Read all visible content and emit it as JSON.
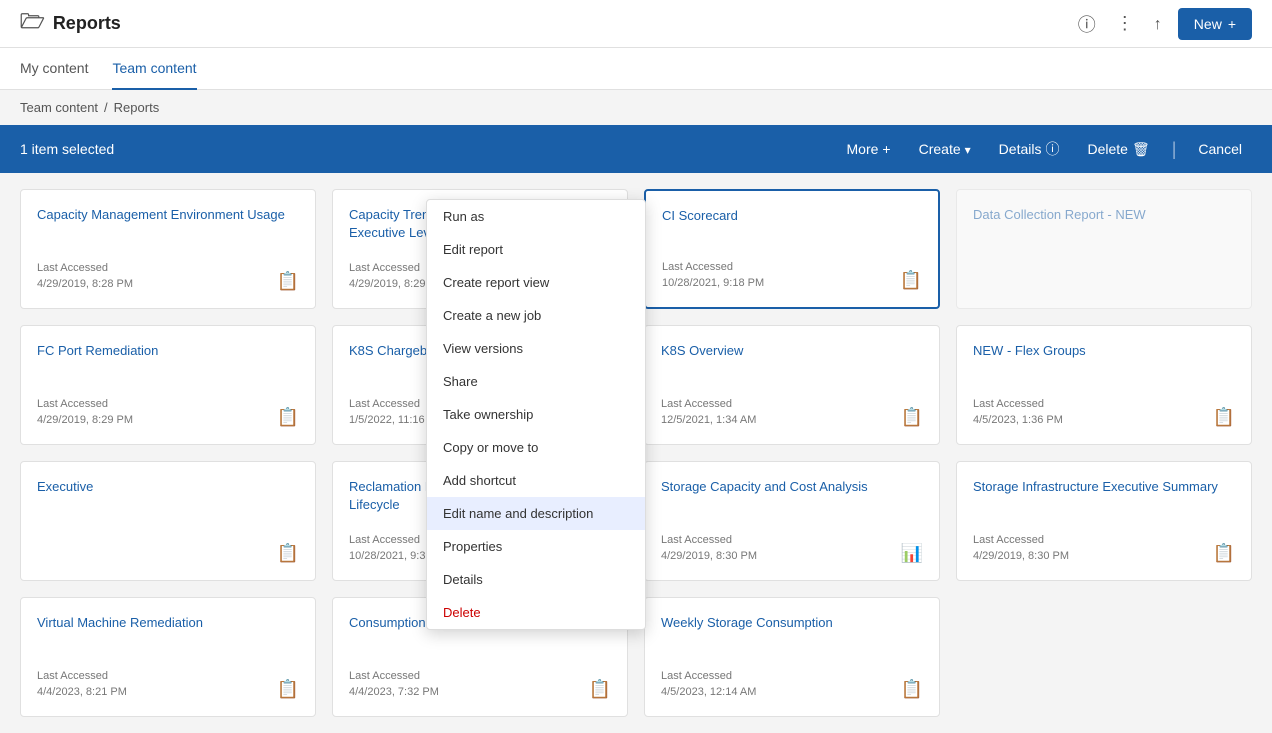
{
  "header": {
    "title": "Reports",
    "folder_icon": "🗁",
    "info_icon": "ⓘ",
    "more_icon": "⋮",
    "upload_icon": "↑",
    "new_label": "New",
    "new_plus": "+"
  },
  "tabs": [
    {
      "id": "my-content",
      "label": "My content",
      "active": false
    },
    {
      "id": "team-content",
      "label": "Team content",
      "active": true
    }
  ],
  "breadcrumb": {
    "links": [
      {
        "label": "Team content",
        "href": "#"
      }
    ],
    "separator": "/",
    "current": "Reports"
  },
  "selection_bar": {
    "count_label": "1 item selected",
    "more_label": "More",
    "more_plus": "+",
    "create_label": "Create",
    "details_label": "Details",
    "details_icon": "ⓘ",
    "delete_label": "Delete",
    "delete_icon": "🗑",
    "cancel_label": "Cancel"
  },
  "cards": [
    {
      "id": "capacity-management",
      "title": "Capacity Management Environment Usage",
      "date_label": "Last Accessed",
      "date": "4/29/2019, 8:28 PM",
      "selected": false
    },
    {
      "id": "capacity-trending",
      "title": "Capacity Trending and Forecasting - Executive Level",
      "date_label": "Last Accessed",
      "date": "4/29/2019, 8:29 PM",
      "selected": false
    },
    {
      "id": "ci-scorecard",
      "title": "CI Scorecard",
      "date_label": "Last Accessed",
      "date": "10/28/2021, 9:18 PM",
      "selected": true
    },
    {
      "id": "data-collection-report",
      "title": "Data Collection Report - NEW",
      "date_label": "",
      "date": "",
      "selected": false,
      "partial": true
    },
    {
      "id": "fc-port-remediation",
      "title": "FC Port Remediation",
      "date_label": "Last Accessed",
      "date": "4/29/2019, 8:29 PM",
      "selected": false
    },
    {
      "id": "k8s-chargeback",
      "title": "K8S Chargeback",
      "date_label": "Last Accessed",
      "date": "1/5/2022, 11:16 PM",
      "selected": false
    },
    {
      "id": "k8s-overview",
      "title": "K8S Overview",
      "date_label": "Last Accessed",
      "date": "12/5/2021, 1:34 AM",
      "selected": false
    },
    {
      "id": "new-flex-groups",
      "title": "NEW - Flex Groups",
      "date_label": "Last Accessed",
      "date": "4/5/2023, 1:36 PM",
      "selected": false
    },
    {
      "id": "reclamation-efficiency",
      "title": "Reclamation Efficiency And Allocation Lifecycle",
      "date_label": "Last Accessed",
      "date": "10/28/2021, 9:31 PM",
      "selected": false
    },
    {
      "id": "storage-capacity",
      "title": "Storage Capacity and Cost Analysis",
      "date_label": "Last Accessed",
      "date": "4/29/2019, 8:30 PM",
      "selected": false
    },
    {
      "id": "storage-infrastructure",
      "title": "Storage Infrastructure Executive Summary",
      "date_label": "Last Accessed",
      "date": "4/29/2019, 8:30 PM",
      "selected": false
    },
    {
      "id": "virtual-machine-remediation",
      "title": "Virtual Machine Remediation",
      "date_label": "Last Accessed",
      "date": "4/4/2023, 8:21 PM",
      "selected": false
    },
    {
      "id": "virtual-machine-storage",
      "title": "Virtual Machine Storage Consumption",
      "date_label": "Last Accessed",
      "date": "4/4/2023, 7:32 PM",
      "selected": false,
      "partial": true,
      "partial_text": "Consumption"
    },
    {
      "id": "weekly-storage-consumption",
      "title": "Weekly Storage Consumption",
      "date_label": "Last Accessed",
      "date": "4/5/2023, 12:14 AM",
      "selected": false
    }
  ],
  "context_menu": {
    "items": [
      {
        "id": "run-as",
        "label": "Run as",
        "bold": true
      },
      {
        "id": "edit-report",
        "label": "Edit report"
      },
      {
        "id": "create-report-view",
        "label": "Create report view"
      },
      {
        "id": "create-new-job",
        "label": "Create a new job"
      },
      {
        "id": "view-versions",
        "label": "View versions"
      },
      {
        "id": "share",
        "label": "Share"
      },
      {
        "id": "take-ownership",
        "label": "Take ownership"
      },
      {
        "id": "copy-or-move",
        "label": "Copy or move to"
      },
      {
        "id": "add-shortcut",
        "label": "Add shortcut"
      },
      {
        "id": "edit-name-description",
        "label": "Edit name and description",
        "highlight": true
      },
      {
        "id": "properties",
        "label": "Properties"
      },
      {
        "id": "details",
        "label": "Details"
      },
      {
        "id": "delete",
        "label": "Delete",
        "danger": true
      }
    ]
  },
  "colors": {
    "primary": "#1a5fa8",
    "card_icon": "#7b68ee",
    "danger": "#cc0000"
  }
}
